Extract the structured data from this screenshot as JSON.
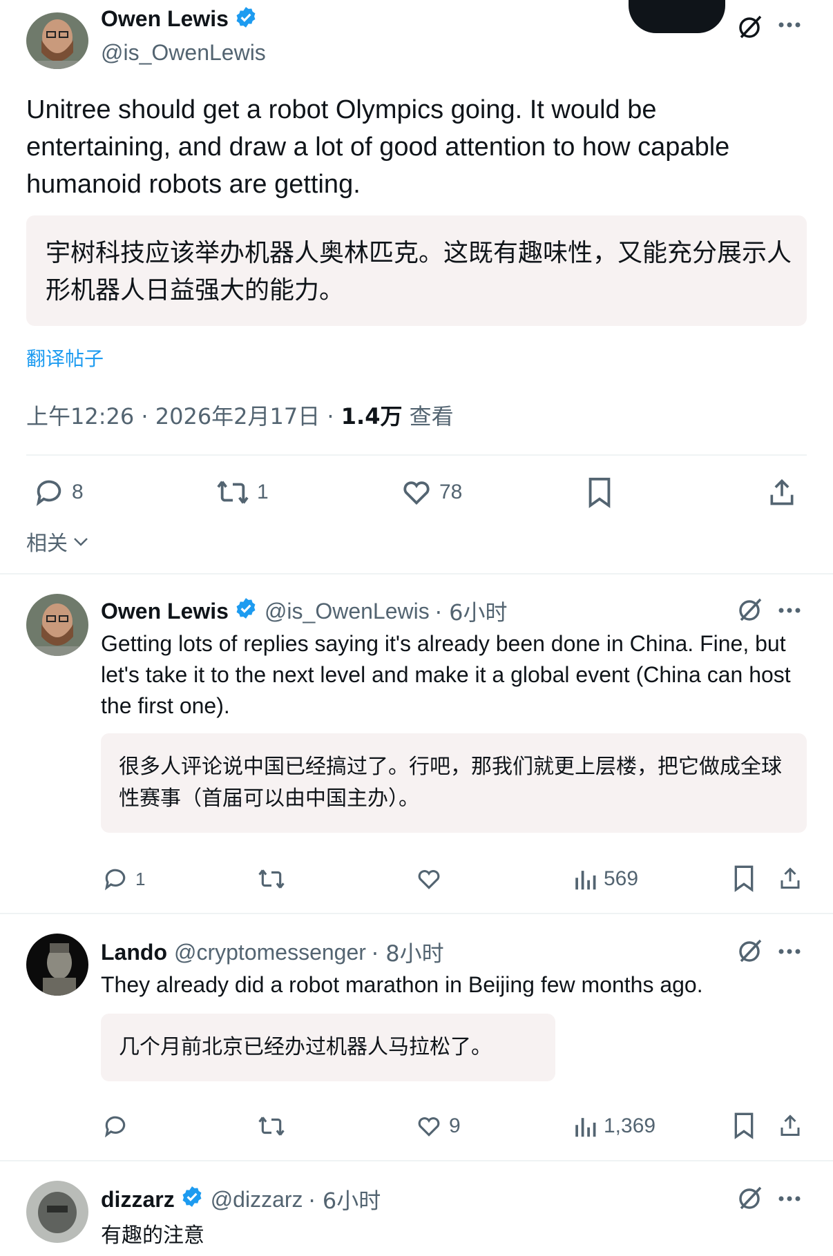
{
  "main_post": {
    "author_name": "Owen Lewis",
    "handle": "@is_OwenLewis",
    "text": "Unitree should get a robot Olympics going. It would be entertaining, and draw a lot of good attention to how capable humanoid robots are getting.",
    "translation": "宇树科技应该举办机器人奥林匹克。这既有趣味性，又能充分展示人形机器人日益强大的能力。",
    "translate_link": "翻译帖子",
    "time": "上午12:26 · 2026年2月17日 · ",
    "views_count": "1.4万",
    "views_label": "查看",
    "stats": {
      "replies": "8",
      "reposts": "1",
      "likes": "78"
    },
    "related_label": "相关"
  },
  "replies": [
    {
      "author_name": "Owen Lewis",
      "handle": "@is_OwenLewis",
      "time": "· 6小时",
      "text": "Getting lots of replies saying it's already been done in China. Fine, but let's take it to the next level and make it a global event (China can host the first one).",
      "translation": "很多人评论说中国已经搞过了。行吧，那我们就更上层楼，把它做成全球性赛事（首届可以由中国主办）。",
      "replies": "1",
      "reposts": "",
      "likes": "",
      "views": "569"
    },
    {
      "author_name": "Lando",
      "handle": "@cryptomessenger",
      "time": "· 8小时",
      "text": "They already did a robot marathon in Beijing few months ago.",
      "translation": "几个月前北京已经办过机器人马拉松了。",
      "replies": "",
      "reposts": "",
      "likes": "9",
      "views": "1,369"
    },
    {
      "author_name": "dizzarz",
      "handle": "@dizzarz",
      "time": "· 6小时",
      "text": "有趣的注意"
    }
  ],
  "colors": {
    "accent": "#1d9bf0",
    "muted": "#536471",
    "translation_bg": "#f7f2f2"
  },
  "icons": [
    "verified-badge-icon",
    "grok-icon",
    "more-icon",
    "reply-icon",
    "repost-icon",
    "like-icon",
    "views-icon",
    "bookmark-icon",
    "share-icon",
    "chevron-down-icon"
  ]
}
